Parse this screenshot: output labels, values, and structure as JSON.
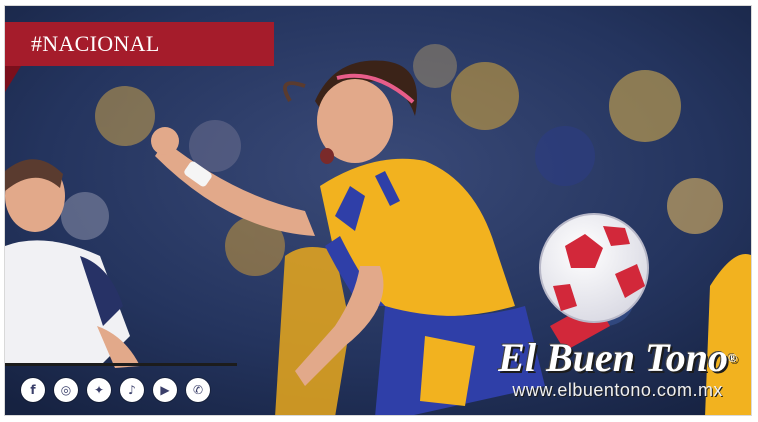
{
  "category_tag": "#NACIONAL",
  "brand": {
    "name": "El Buen Tono",
    "registered_mark": "®",
    "url": "www.elbuentono.com.mx"
  },
  "socials": [
    {
      "icon": "facebook-icon",
      "glyph": "f"
    },
    {
      "icon": "instagram-icon",
      "glyph": "◎"
    },
    {
      "icon": "twitter-icon",
      "glyph": "✦"
    },
    {
      "icon": "tiktok-icon",
      "glyph": "♪"
    },
    {
      "icon": "youtube-icon",
      "glyph": "▶"
    },
    {
      "icon": "whatsapp-icon",
      "glyph": "✆"
    }
  ],
  "colors": {
    "tag_bg": "#a51c2b",
    "jersey_yellow": "#f2b21f",
    "jersey_blue": "#2f3fa8"
  }
}
